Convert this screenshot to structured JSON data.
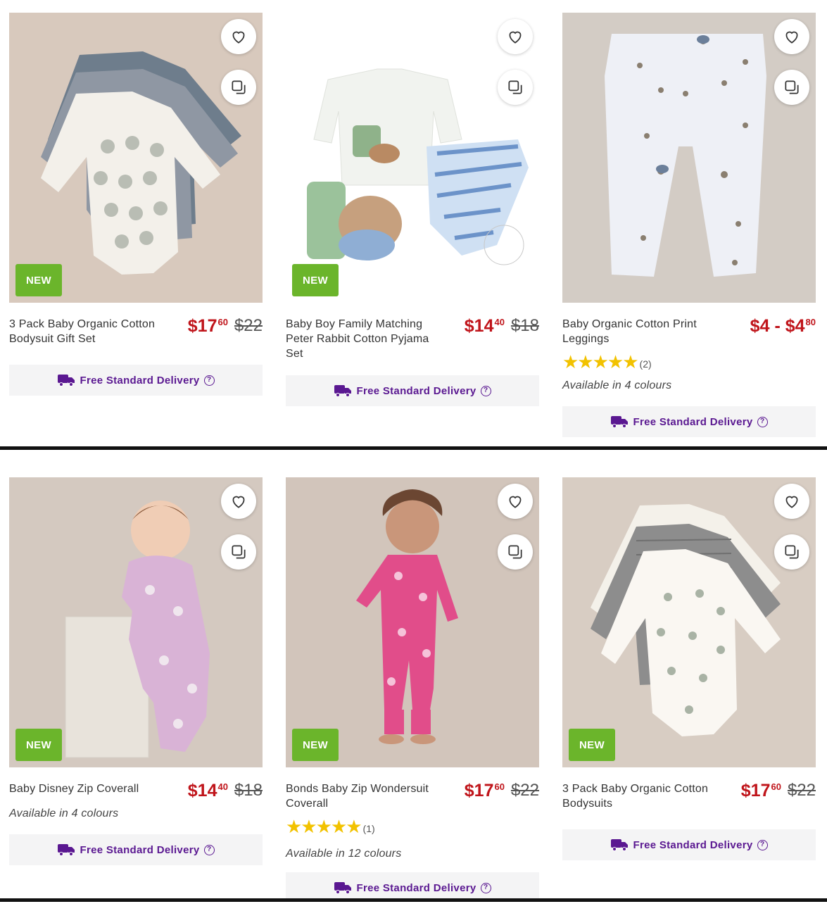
{
  "products": [
    {
      "title": "3 Pack Baby Organic Cotton Bodysuit Gift Set",
      "price_dollars": "$17",
      "price_cents": "60",
      "price_was": "$22",
      "badge": "NEW",
      "delivery": "Free Standard Delivery"
    },
    {
      "title": "Baby Boy Family Matching Peter Rabbit Cotton Pyjama Set",
      "price_dollars": "$14",
      "price_cents": "40",
      "price_was": "$18",
      "badge": "NEW",
      "delivery": "Free Standard Delivery"
    },
    {
      "title": "Baby Organic Cotton Print Leggings",
      "price_range_low": "$4",
      "price_range_sep": "-",
      "price_range_high_dollars": "$4",
      "price_range_high_cents": "80",
      "rating": 5,
      "rating_count": "(2)",
      "colours": "Available in 4 colours",
      "delivery": "Free Standard Delivery"
    },
    {
      "title": "Baby Disney Zip Coverall",
      "price_dollars": "$14",
      "price_cents": "40",
      "price_was": "$18",
      "badge": "NEW",
      "colours": "Available in 4 colours",
      "delivery": "Free Standard Delivery"
    },
    {
      "title": "Bonds Baby Zip Wondersuit Coverall",
      "price_dollars": "$17",
      "price_cents": "60",
      "price_was": "$22",
      "badge": "NEW",
      "rating": 5,
      "rating_count": "(1)",
      "colours": "Available in 12 colours",
      "delivery": "Free Standard Delivery"
    },
    {
      "title": "3 Pack Baby Organic Cotton Bodysuits",
      "price_dollars": "$17",
      "price_cents": "60",
      "price_was": "$22",
      "badge": "NEW",
      "delivery": "Free Standard Delivery"
    }
  ],
  "stars_glyph": "★★★★★",
  "help_glyph": "?",
  "icons": {
    "favourite": "heart-icon",
    "quick_view": "copy-icon",
    "delivery": "truck-icon",
    "help": "help-icon"
  },
  "colors": {
    "price_red": "#c0151b",
    "badge_green": "#6bb52b",
    "delivery_purple": "#5a1891",
    "star_gold": "#f2c200"
  }
}
